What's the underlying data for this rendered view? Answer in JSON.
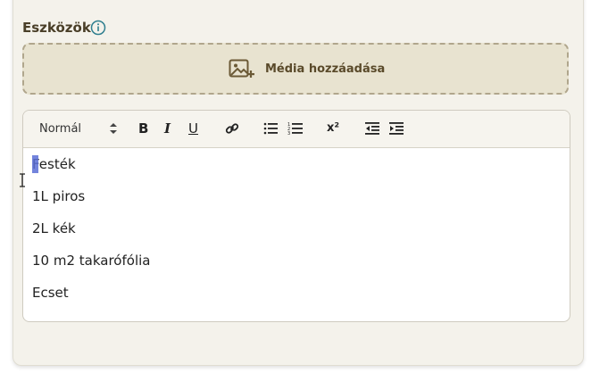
{
  "section": {
    "title": "Eszközök",
    "info_icon": "info-circle-icon"
  },
  "media": {
    "label": "Média hozzáadása",
    "icon": "image-add-icon"
  },
  "toolbar": {
    "format_selected": "Normál",
    "buttons": [
      "bold-icon",
      "italic-icon",
      "underline-icon",
      "link-icon",
      "bullet-list-icon",
      "numbered-list-icon",
      "superscript-icon",
      "outdent-icon",
      "indent-icon"
    ],
    "bold_glyph": "B",
    "italic_glyph": "I",
    "underline_glyph": "U",
    "superscript_glyph": "x²"
  },
  "editor": {
    "lines": [
      "Festék",
      "1L piros",
      "2L kék",
      "10 m2 takarófólia",
      "Ecset"
    ]
  },
  "colors": {
    "accent": "#2f7f8f",
    "title": "#4a3f28",
    "selection": "#5b6fd6"
  }
}
